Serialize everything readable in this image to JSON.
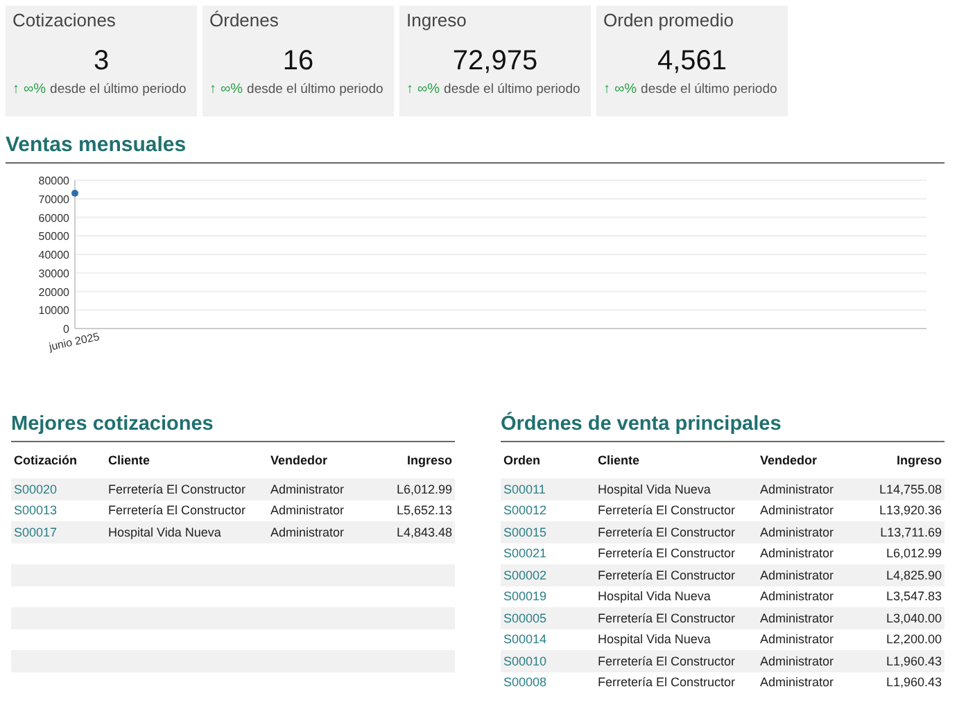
{
  "kpis": [
    {
      "title": "Cotizaciones",
      "value": "3",
      "delta": {
        "arrow": "↑",
        "change": "∞%",
        "text": "desde el último periodo"
      }
    },
    {
      "title": "Órdenes",
      "value": "16",
      "delta": {
        "arrow": "↑",
        "change": "∞%",
        "text": "desde el último periodo"
      }
    },
    {
      "title": "Ingreso",
      "value": "72,975",
      "delta": {
        "arrow": "↑",
        "change": "∞%",
        "text": "desde el último periodo"
      }
    },
    {
      "title": "Orden promedio",
      "value": "4,561",
      "delta": {
        "arrow": "↑",
        "change": "∞%",
        "text": "desde el último periodo"
      }
    }
  ],
  "monthly_sales": {
    "title": "Ventas mensuales",
    "chart_data": {
      "type": "line",
      "categories": [
        "junio 2025"
      ],
      "series": [
        {
          "color": "#2f6fa8",
          "marker": true,
          "values": [
            73000
          ]
        }
      ],
      "grid": true,
      "ylim": [
        0,
        80000
      ],
      "yticks": [
        0,
        10000,
        20000,
        30000,
        40000,
        50000,
        60000,
        70000,
        80000
      ]
    }
  },
  "top_quotes": {
    "title": "Mejores cotizaciones",
    "columns": [
      "Cotización",
      "Cliente",
      "Vendedor",
      "Ingreso"
    ],
    "rows": [
      [
        "S00020",
        "Ferretería El Constructor",
        "Administrator",
        "L6,012.99"
      ],
      [
        "S00013",
        "Ferretería El Constructor",
        "Administrator",
        "L5,652.13"
      ],
      [
        "S00017",
        "Hospital Vida Nueva",
        "Administrator",
        "L4,843.48"
      ]
    ]
  },
  "top_orders": {
    "title": "Órdenes de venta principales",
    "columns": [
      "Orden",
      "Cliente",
      "Vendedor",
      "Ingreso"
    ],
    "rows": [
      [
        "S00011",
        "Hospital Vida Nueva",
        "Administrator",
        "L14,755.08"
      ],
      [
        "S00012",
        "Ferretería El Constructor",
        "Administrator",
        "L13,920.36"
      ],
      [
        "S00015",
        "Ferretería El Constructor",
        "Administrator",
        "L13,711.69"
      ],
      [
        "S00021",
        "Ferretería El Constructor",
        "Administrator",
        "L6,012.99"
      ],
      [
        "S00002",
        "Ferretería El Constructor",
        "Administrator",
        "L4,825.90"
      ],
      [
        "S00019",
        "Hospital Vida Nueva",
        "Administrator",
        "L3,547.83"
      ],
      [
        "S00005",
        "Ferretería El Constructor",
        "Administrator",
        "L3,040.00"
      ],
      [
        "S00014",
        "Hospital Vida Nueva",
        "Administrator",
        "L2,200.00"
      ],
      [
        "S00010",
        "Ferretería El Constructor",
        "Administrator",
        "L1,960.43"
      ],
      [
        "S00008",
        "Ferretería El Constructor",
        "Administrator",
        "L1,960.43"
      ]
    ]
  }
}
